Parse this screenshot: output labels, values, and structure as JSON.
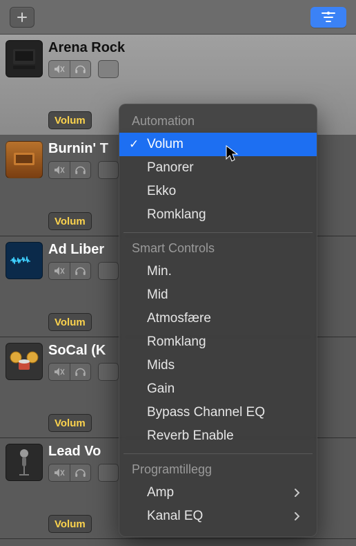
{
  "colors": {
    "accent": "#1d6ff2",
    "param": "#fcd34d"
  },
  "topbar": {
    "add": "+",
    "filter": "filter"
  },
  "tracks": [
    {
      "title": "Arena Rock",
      "param": "Volum",
      "selected": true,
      "thumb": "amp"
    },
    {
      "title": "Burnin' T",
      "param": "Volum",
      "selected": false,
      "thumb": "amp-orange"
    },
    {
      "title": "Ad Liber",
      "param": "Volum",
      "selected": false,
      "thumb": "wave"
    },
    {
      "title": "SoCal (K",
      "param": "Volum",
      "selected": false,
      "thumb": "drums"
    },
    {
      "title": "Lead Vo",
      "param": "Volum",
      "selected": false,
      "thumb": "mic"
    }
  ],
  "menu": {
    "sections": [
      {
        "header": "Automation",
        "items": [
          {
            "label": "Volum",
            "checked": true,
            "highlight": true
          },
          {
            "label": "Panorer"
          },
          {
            "label": "Ekko"
          },
          {
            "label": "Romklang"
          }
        ]
      },
      {
        "header": "Smart Controls",
        "items": [
          {
            "label": "Min."
          },
          {
            "label": "Mid"
          },
          {
            "label": "Atmosfære"
          },
          {
            "label": "Romklang"
          },
          {
            "label": "Mids"
          },
          {
            "label": "Gain"
          },
          {
            "label": "Bypass Channel EQ"
          },
          {
            "label": "Reverb Enable"
          }
        ]
      },
      {
        "header": "Programtillegg",
        "items": [
          {
            "label": "Amp",
            "submenu": true
          },
          {
            "label": "Kanal EQ",
            "submenu": true
          }
        ]
      }
    ]
  }
}
